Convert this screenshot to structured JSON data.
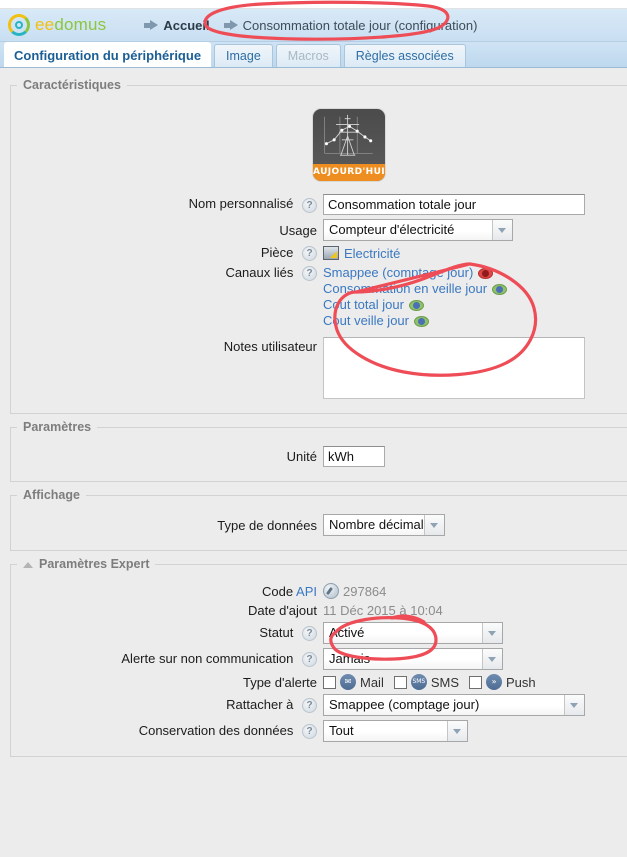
{
  "header": {
    "logo_text_1": "ee",
    "logo_text_2": "domus",
    "home_label": "Accueil",
    "breadcrumb_current": "Consommation totale jour (configuration)"
  },
  "tabs": [
    {
      "label": "Configuration du périphérique",
      "state": "active"
    },
    {
      "label": "Image",
      "state": "enabled"
    },
    {
      "label": "Macros",
      "state": "disabled"
    },
    {
      "label": "Règles associées",
      "state": "enabled"
    }
  ],
  "sections": {
    "caracteristiques": {
      "legend": "Caractéristiques",
      "thumbnail_banner": "AUJOURD'HUI",
      "nom_personnalise": {
        "label": "Nom personnalisé",
        "value": "Consommation totale jour"
      },
      "usage": {
        "label": "Usage",
        "value": "Compteur d'électricité"
      },
      "piece": {
        "label": "Pièce",
        "value": "Electricité"
      },
      "canaux_lies": {
        "label": "Canaux liés",
        "items": [
          {
            "name": "Smappee (comptage jour)",
            "visibility": "hidden"
          },
          {
            "name": "Consommation en veille jour",
            "visibility": "visible"
          },
          {
            "name": "Cout total jour",
            "visibility": "visible"
          },
          {
            "name": "Cout veille jour",
            "visibility": "visible"
          }
        ]
      },
      "notes_utilisateur": {
        "label": "Notes utilisateur",
        "value": ""
      }
    },
    "parametres": {
      "legend": "Paramètres",
      "unite": {
        "label": "Unité",
        "value": "kWh"
      }
    },
    "affichage": {
      "legend": "Affichage",
      "type_de_donnees": {
        "label": "Type de données",
        "value": "Nombre décimal"
      }
    },
    "parametres_expert": {
      "legend": "Paramètres Expert",
      "code_api": {
        "label": "Code",
        "label_link": "API",
        "value": "297864"
      },
      "date_ajout": {
        "label": "Date d'ajout",
        "value": "11 Déc 2015 à 10:04"
      },
      "statut": {
        "label": "Statut",
        "value": "Activé"
      },
      "alerte_non_communication": {
        "label": "Alerte sur non communication",
        "value": "Jamais"
      },
      "type_alerte": {
        "label": "Type d'alerte",
        "options": [
          {
            "label": "Mail",
            "icon": "mail-icon",
            "icon_glyph": "✉",
            "checked": false
          },
          {
            "label": "SMS",
            "icon": "sms-icon",
            "icon_glyph": "SMS",
            "checked": false
          },
          {
            "label": "Push",
            "icon": "push-icon",
            "icon_glyph": "»",
            "checked": false
          }
        ]
      },
      "rattacher_a": {
        "label": "Rattacher à",
        "value": "Smappee (comptage jour)"
      },
      "conservation_donnees": {
        "label": "Conservation des données",
        "value": "Tout"
      }
    }
  },
  "colors": {
    "accent_blue": "#3a78c2",
    "header_blue": "#c9dff2",
    "annotation_red": "#ee4d57",
    "banner_orange": "#ef8e20",
    "eye_visible": "#8fc06a",
    "eye_hidden": "#e04747"
  },
  "help_icon_char": "?"
}
